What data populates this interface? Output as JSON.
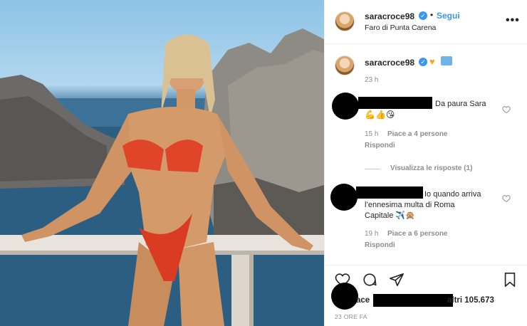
{
  "post": {
    "username": "saracroce98",
    "follow_label": "Segui",
    "location": "Faro di Punta Carena",
    "caption_time": "23 h",
    "likes_text_suffix": "altri 105.673",
    "likes_text_prefix": "ace",
    "post_age": "23 ORE FA"
  },
  "comments": [
    {
      "text_line1": "Da paura Sara",
      "emoji_line": "💪👍😘",
      "time": "15 h",
      "likes": "Piace a 4 persone",
      "reply": "Rispondi"
    },
    {
      "text_line1": "Io quando arriva",
      "text_line2": "l’ennesima multa di Roma",
      "text_line3": "Capitale ✈️🙊",
      "time": "19 h",
      "likes": "Piace a 6 persone",
      "reply": "Rispondi"
    }
  ],
  "view_replies": "Visualizza le risposte (1)",
  "colors": {
    "accent": "#3897f0",
    "text": "#262626",
    "muted": "#8e8e8e"
  },
  "icons": [
    "verified-icon",
    "more-icon",
    "heart-icon",
    "comment-icon",
    "share-icon",
    "bookmark-icon"
  ]
}
